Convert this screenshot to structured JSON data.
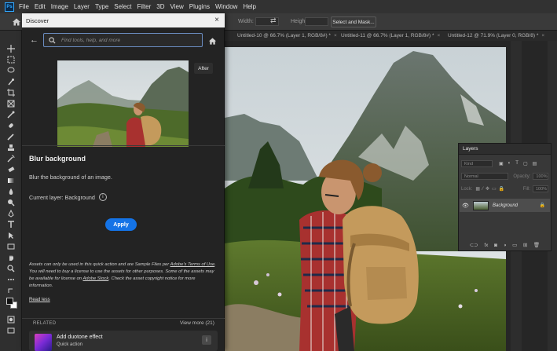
{
  "menubar": {
    "logo": "Ps",
    "items": [
      "File",
      "Edit",
      "Image",
      "Layer",
      "Type",
      "Select",
      "Filter",
      "3D",
      "View",
      "Plugins",
      "Window",
      "Help"
    ]
  },
  "options": {
    "width_label": "Width:",
    "height_label": "Height:",
    "select_mask": "Select and Mask..."
  },
  "tabs": [
    "Untitled-10 @ 66.7% (Layer 1, RGB/8#) *",
    "Untitled-11 @ 66.7% (Layer 1, RGB/8#) *",
    "Untitled-12 @ 71.9% (Layer 0, RGB/8) *"
  ],
  "discover": {
    "title": "Discover",
    "search_placeholder": "Find tools, help, and more",
    "after_badge": "After",
    "action_title": "Blur background",
    "action_desc": "Blur the background of an image.",
    "current_layer": "Current layer: Background",
    "info_glyph": "i",
    "apply": "Apply",
    "disclaimer_1": "Assets can only be used in this quick action and are Sample Files per ",
    "terms_link": "Adobe's Terms of Use",
    "disclaimer_2": ". You will need to buy a license to use the assets for other purposes. Some of the assets may be available for license on ",
    "stock_link": "Adobe Stock",
    "disclaimer_3": ". Check the asset copyright notice for more information.",
    "read_less": "Read less",
    "related": "RELATED",
    "view_more": "View more (21)",
    "related_item_name": "Add duotone effect",
    "related_item_sub": "Quick action"
  },
  "layers_panel": {
    "title": "Layers",
    "kind": "Kind",
    "blend": "Normal",
    "opacity_label": "Opacity:",
    "opacity": "100%",
    "lock_label": "Lock:",
    "fill_label": "Fill:",
    "fill": "100%",
    "layer_name": "Background"
  },
  "icons": {
    "close": "×",
    "back": "←",
    "eye": "👁",
    "lock": "🔒",
    "swap": "⇄"
  },
  "colors": {
    "accent": "#1473e6",
    "panel_bg": "#232323",
    "titlebar": "#f0f0f0"
  }
}
